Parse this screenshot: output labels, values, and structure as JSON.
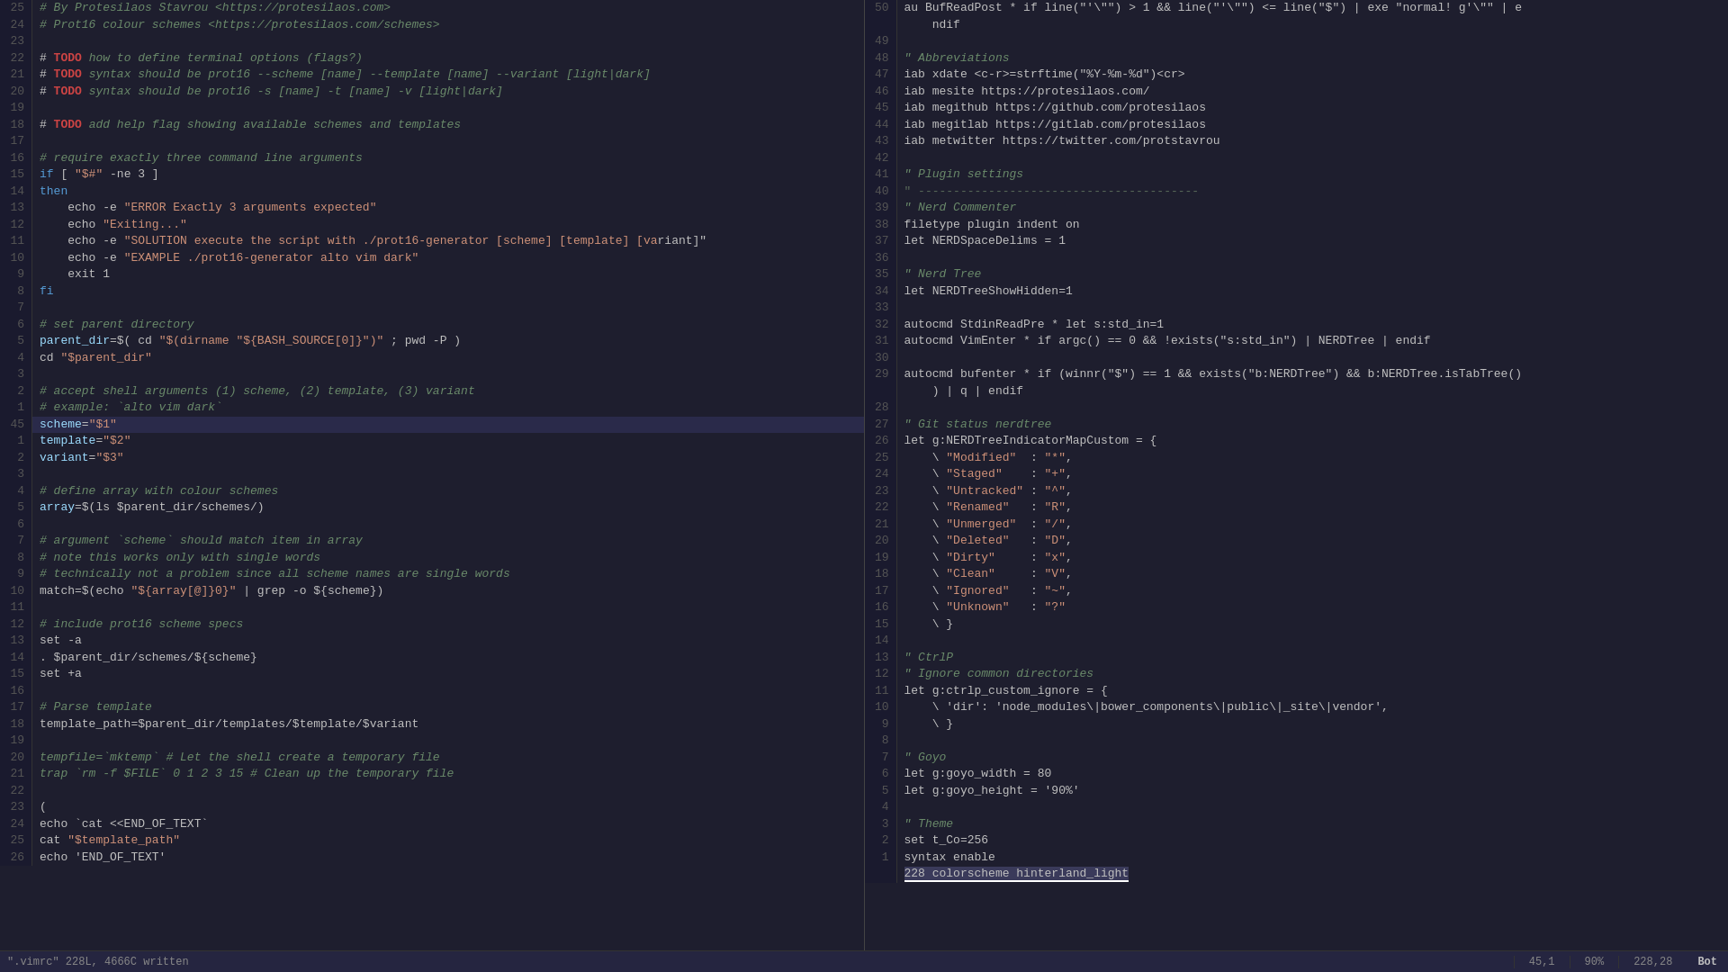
{
  "left_pane": {
    "lines": [
      {
        "num": "25",
        "content": [
          {
            "t": "# By Protesilaos Stavrou <https://protesilaos.com>",
            "c": "c-comment"
          }
        ]
      },
      {
        "num": "24",
        "content": [
          {
            "t": "# Prot16 colour schemes <https://protesilaos.com/schemes>",
            "c": "c-comment"
          }
        ]
      },
      {
        "num": "23",
        "content": []
      },
      {
        "num": "22",
        "content": [
          {
            "t": "# "
          },
          {
            "t": "TODO",
            "c": "c-todo"
          },
          {
            "t": " how to define terminal options (flags?)",
            "c": "c-comment"
          }
        ]
      },
      {
        "num": "21",
        "content": [
          {
            "t": "# "
          },
          {
            "t": "TODO",
            "c": "c-todo"
          },
          {
            "t": " syntax should be prot16 --scheme [name] --template [name] --variant [light|dark]",
            "c": "c-comment"
          }
        ]
      },
      {
        "num": "20",
        "content": [
          {
            "t": "# "
          },
          {
            "t": "TODO",
            "c": "c-todo"
          },
          {
            "t": " syntax should be prot16 -s [name] -t [name] -v [light|dark]",
            "c": "c-comment"
          }
        ]
      },
      {
        "num": "19",
        "content": []
      },
      {
        "num": "18",
        "content": [
          {
            "t": "# "
          },
          {
            "t": "TODO",
            "c": "c-todo"
          },
          {
            "t": " add help flag showing available schemes and templates",
            "c": "c-comment"
          }
        ]
      },
      {
        "num": "17",
        "content": []
      },
      {
        "num": "16",
        "content": [
          {
            "t": "# require exactly three command line arguments",
            "c": "c-comment"
          }
        ]
      },
      {
        "num": "15",
        "content": [
          {
            "t": "if",
            "c": "c-keyword"
          },
          {
            "t": " [ "
          },
          {
            "t": "\"$#\"",
            "c": "c-string"
          },
          {
            "t": " -ne 3 ]"
          }
        ]
      },
      {
        "num": "14",
        "content": [
          {
            "t": "then",
            "c": "c-keyword"
          }
        ]
      },
      {
        "num": "13",
        "content": [
          {
            "t": "    echo -e "
          },
          {
            "t": "\"ERROR Exactly 3 arguments expected\"",
            "c": "c-string"
          }
        ]
      },
      {
        "num": "12",
        "content": [
          {
            "t": "    echo "
          },
          {
            "t": "\"Exiting...\"",
            "c": "c-string"
          }
        ]
      },
      {
        "num": "11",
        "content": [
          {
            "t": "    echo -e "
          },
          {
            "t": "\"SOLUTION execute the script with ./prot16-generator [scheme] [template] [va",
            "c": "c-string"
          },
          {
            "t": "riant]\""
          }
        ]
      },
      {
        "num": "10",
        "content": [
          {
            "t": "    echo -e "
          },
          {
            "t": "\"EXAMPLE ./prot16-generator alto vim dark\"",
            "c": "c-string"
          }
        ]
      },
      {
        "num": " 9",
        "content": [
          {
            "t": "    exit 1"
          }
        ]
      },
      {
        "num": " 8",
        "content": [
          {
            "t": "fi",
            "c": "c-keyword"
          }
        ]
      },
      {
        "num": " 7",
        "content": []
      },
      {
        "num": " 6",
        "content": [
          {
            "t": "# set parent directory",
            "c": "c-comment"
          }
        ]
      },
      {
        "num": " 5",
        "content": [
          {
            "t": "parent_dir",
            "c": "c-var"
          },
          {
            "t": "=$( cd "
          },
          {
            "t": "\"$(dirname \"${BASH_SOURCE[0]}\")\"",
            "c": "c-string"
          },
          {
            "t": " ; pwd -P )"
          }
        ]
      },
      {
        "num": " 4",
        "content": [
          {
            "t": "cd "
          },
          {
            "t": "\"$parent_dir\"",
            "c": "c-string"
          }
        ]
      },
      {
        "num": " 3",
        "content": []
      },
      {
        "num": " 2",
        "content": [
          {
            "t": "# accept shell arguments (1) scheme, (2) template, (3) variant",
            "c": "c-comment"
          }
        ]
      },
      {
        "num": " 1",
        "content": [
          {
            "t": "# example: `alto vim dark`",
            "c": "c-comment"
          }
        ]
      },
      {
        "num": "45",
        "highlighted": true,
        "content": [
          {
            "t": "scheme",
            "c": "c-var"
          },
          {
            "t": "="
          },
          {
            "t": "\"$1\"",
            "c": "c-string"
          }
        ]
      },
      {
        "num": " 1",
        "content": [
          {
            "t": "template",
            "c": "c-var"
          },
          {
            "t": "="
          },
          {
            "t": "\"$2\"",
            "c": "c-string"
          }
        ]
      },
      {
        "num": " 2",
        "content": [
          {
            "t": "variant",
            "c": "c-var"
          },
          {
            "t": "="
          },
          {
            "t": "\"$3\"",
            "c": "c-string"
          }
        ]
      },
      {
        "num": " 3",
        "content": []
      },
      {
        "num": " 4",
        "content": [
          {
            "t": "# define array with colour schemes",
            "c": "c-comment"
          }
        ]
      },
      {
        "num": " 5",
        "content": [
          {
            "t": "array",
            "c": "c-var"
          },
          {
            "t": "=$(ls $parent_dir/schemes/)"
          }
        ]
      },
      {
        "num": " 6",
        "content": []
      },
      {
        "num": " 7",
        "content": [
          {
            "t": "# argument `scheme` should match item in array",
            "c": "c-comment"
          }
        ]
      },
      {
        "num": " 8",
        "content": [
          {
            "t": "# note this works only with single words",
            "c": "c-comment"
          }
        ]
      },
      {
        "num": " 9",
        "content": [
          {
            "t": "# technically not a problem since all scheme names are single words",
            "c": "c-comment"
          }
        ]
      },
      {
        "num": "10",
        "content": [
          {
            "t": "match=$(echo "
          },
          {
            "t": "\"${array[@]}",
            "c": "c-string"
          },
          {
            "t": "0}",
            "c": "c-string"
          },
          {
            "t": "\"",
            "c": "c-string"
          },
          {
            "t": " | grep -o ${scheme})"
          }
        ]
      },
      {
        "num": "11",
        "content": []
      },
      {
        "num": "12",
        "content": [
          {
            "t": "# include prot16 scheme specs",
            "c": "c-comment"
          }
        ]
      },
      {
        "num": "13",
        "content": [
          {
            "t": "set -a"
          }
        ]
      },
      {
        "num": "14",
        "content": [
          {
            "t": ". $parent_dir/schemes/${scheme}"
          }
        ]
      },
      {
        "num": "15",
        "content": [
          {
            "t": "set +a"
          }
        ]
      },
      {
        "num": "16",
        "content": []
      },
      {
        "num": "17",
        "content": [
          {
            "t": "# Parse template",
            "c": "c-comment"
          }
        ]
      },
      {
        "num": "18",
        "content": [
          {
            "t": "template_path=$parent_dir/templates/$template/$variant"
          }
        ]
      },
      {
        "num": "19",
        "content": []
      },
      {
        "num": "20",
        "content": [
          {
            "t": "tempfile=`mktemp` # Let the shell create a temporary file",
            "c": "c-comment"
          }
        ]
      },
      {
        "num": "21",
        "content": [
          {
            "t": "trap `rm -f $FILE` 0 1 2 3 15 # Clean up the temporary file",
            "c": "c-comment"
          }
        ]
      },
      {
        "num": "22",
        "content": []
      },
      {
        "num": "23",
        "content": [
          {
            "t": "("
          }
        ]
      },
      {
        "num": "24",
        "content": [
          {
            "t": "echo `cat <<END_OF_TEXT`"
          }
        ]
      },
      {
        "num": "25",
        "content": [
          {
            "t": "cat "
          },
          {
            "t": "\"$template_path\"",
            "c": "c-string"
          }
        ]
      },
      {
        "num": "26",
        "content": [
          {
            "t": "echo 'END_OF_TEXT'"
          }
        ]
      }
    ]
  },
  "right_pane": {
    "lines": [
      {
        "num": "50",
        "content": [
          {
            "t": "au BufReadPost * if line(\"'\\\"\") > 1 && line(\"'\\\"\") <= line(\"$\") | exe \"normal! g'\\\"\" | e"
          }
        ]
      },
      {
        "num": "",
        "content": [
          {
            "t": "    ndif"
          }
        ]
      },
      {
        "num": "49",
        "content": []
      },
      {
        "num": "48",
        "content": [
          {
            "t": "\" Abbreviations",
            "c": "c-comment"
          }
        ]
      },
      {
        "num": "47",
        "content": [
          {
            "t": "iab xdate <c-r>=strftime(\"%Y-%m-%d\")<cr>"
          }
        ]
      },
      {
        "num": "46",
        "content": [
          {
            "t": "iab mesite https://protesilaos.com/"
          }
        ]
      },
      {
        "num": "45",
        "content": [
          {
            "t": "iab megithub https://github.com/protesilaos"
          }
        ]
      },
      {
        "num": "44",
        "content": [
          {
            "t": "iab megitlab https://gitlab.com/protesilaos"
          }
        ]
      },
      {
        "num": "43",
        "content": [
          {
            "t": "iab metwitter https://twitter.com/protstavrou"
          }
        ]
      },
      {
        "num": "42",
        "content": []
      },
      {
        "num": "41",
        "content": [
          {
            "t": "\" Plugin settings",
            "c": "c-comment"
          }
        ]
      },
      {
        "num": "40",
        "content": [
          {
            "t": "\" ----------------------------------------",
            "c": "c-dimmed"
          }
        ]
      },
      {
        "num": "39",
        "content": [
          {
            "t": "\" Nerd Commenter",
            "c": "c-comment"
          }
        ]
      },
      {
        "num": "38",
        "content": [
          {
            "t": "filetype plugin indent on"
          }
        ]
      },
      {
        "num": "37",
        "content": [
          {
            "t": "let NERDSpaceDelims = 1"
          }
        ]
      },
      {
        "num": "36",
        "content": []
      },
      {
        "num": "35",
        "content": [
          {
            "t": "\" Nerd Tree",
            "c": "c-comment"
          }
        ]
      },
      {
        "num": "34",
        "content": [
          {
            "t": "let NERDTreeShowHidden=1"
          }
        ]
      },
      {
        "num": "33",
        "content": []
      },
      {
        "num": "32",
        "content": [
          {
            "t": "autocmd StdinReadPre * let s:std_in=1"
          }
        ]
      },
      {
        "num": "31",
        "content": [
          {
            "t": "autocmd VimEnter * if argc() == 0 && !exists(\"s:std_in\") | NERDTree | endif"
          }
        ]
      },
      {
        "num": "30",
        "content": []
      },
      {
        "num": "29",
        "content": [
          {
            "t": "autocmd bufenter * if (winnr(\"$\") == 1 && exists(\"b:NERDTree\") && b:NERDTree.isTabTree()"
          }
        ]
      },
      {
        "num": "",
        "content": [
          {
            "t": "    ) | q | endif"
          }
        ]
      },
      {
        "num": "28",
        "content": []
      },
      {
        "num": "27",
        "content": [
          {
            "t": "\" Git status nerdtree",
            "c": "c-comment"
          }
        ]
      },
      {
        "num": "26",
        "content": [
          {
            "t": "let g:NERDTreeIndicatorMapCustom = {"
          }
        ]
      },
      {
        "num": "25",
        "content": [
          {
            "t": "    \\ "
          },
          {
            "t": "\"Modified\"",
            "c": "c-string"
          },
          {
            "t": "  : "
          },
          {
            "t": "\"*\"",
            "c": "c-string"
          },
          {
            "t": ","
          }
        ]
      },
      {
        "num": "24",
        "content": [
          {
            "t": "    \\ "
          },
          {
            "t": "\"Staged\"",
            "c": "c-string"
          },
          {
            "t": "    : "
          },
          {
            "t": "\"+\"",
            "c": "c-string"
          },
          {
            "t": ","
          }
        ]
      },
      {
        "num": "23",
        "content": [
          {
            "t": "    \\ "
          },
          {
            "t": "\"Untracked\"",
            "c": "c-string"
          },
          {
            "t": " : "
          },
          {
            "t": "\"^\"",
            "c": "c-string"
          },
          {
            "t": ","
          }
        ]
      },
      {
        "num": "22",
        "content": [
          {
            "t": "    \\ "
          },
          {
            "t": "\"Renamed\"",
            "c": "c-string"
          },
          {
            "t": "   : "
          },
          {
            "t": "\"R\"",
            "c": "c-string"
          },
          {
            "t": ","
          }
        ]
      },
      {
        "num": "21",
        "content": [
          {
            "t": "    \\ "
          },
          {
            "t": "\"Unmerged\"",
            "c": "c-string"
          },
          {
            "t": "  : "
          },
          {
            "t": "\"/\"",
            "c": "c-string"
          },
          {
            "t": ","
          }
        ]
      },
      {
        "num": "20",
        "content": [
          {
            "t": "    \\ "
          },
          {
            "t": "\"Deleted\"",
            "c": "c-string"
          },
          {
            "t": "   : "
          },
          {
            "t": "\"D\"",
            "c": "c-string"
          },
          {
            "t": ","
          }
        ]
      },
      {
        "num": "19",
        "content": [
          {
            "t": "    \\ "
          },
          {
            "t": "\"Dirty\"",
            "c": "c-string"
          },
          {
            "t": "     : "
          },
          {
            "t": "\"x\"",
            "c": "c-string"
          },
          {
            "t": ","
          }
        ]
      },
      {
        "num": "18",
        "content": [
          {
            "t": "    \\ "
          },
          {
            "t": "\"Clean\"",
            "c": "c-string"
          },
          {
            "t": "     : "
          },
          {
            "t": "\"V\"",
            "c": "c-string"
          },
          {
            "t": ","
          }
        ]
      },
      {
        "num": "17",
        "content": [
          {
            "t": "    \\ "
          },
          {
            "t": "\"Ignored\"",
            "c": "c-string"
          },
          {
            "t": "   : "
          },
          {
            "t": "\"~\"",
            "c": "c-string"
          },
          {
            "t": ","
          }
        ]
      },
      {
        "num": "16",
        "content": [
          {
            "t": "    \\ "
          },
          {
            "t": "\"Unknown\"",
            "c": "c-string"
          },
          {
            "t": "   : "
          },
          {
            "t": "\"?\"",
            "c": "c-string"
          }
        ]
      },
      {
        "num": "15",
        "content": [
          {
            "t": "    \\ }"
          }
        ]
      },
      {
        "num": "14",
        "content": []
      },
      {
        "num": "13",
        "content": [
          {
            "t": "\" CtrlP",
            "c": "c-comment"
          }
        ]
      },
      {
        "num": "12",
        "content": [
          {
            "t": "\" Ignore common directories",
            "c": "c-comment"
          }
        ]
      },
      {
        "num": "11",
        "content": [
          {
            "t": "let g:ctrlp_custom_ignore = {"
          }
        ]
      },
      {
        "num": "10",
        "content": [
          {
            "t": "    \\ 'dir': 'node_modules\\|bower_components\\|public\\|_site\\|vendor',"
          }
        ]
      },
      {
        "num": " 9",
        "content": [
          {
            "t": "    \\ }"
          }
        ]
      },
      {
        "num": " 8",
        "content": []
      },
      {
        "num": " 7",
        "content": [
          {
            "t": "\" Goyo",
            "c": "c-comment"
          }
        ]
      },
      {
        "num": " 6",
        "content": [
          {
            "t": "let g:goyo_width = 80"
          }
        ]
      },
      {
        "num": " 5",
        "content": [
          {
            "t": "let g:goyo_height = '90%'"
          }
        ]
      },
      {
        "num": " 4",
        "content": []
      },
      {
        "num": " 3",
        "content": [
          {
            "t": "\" Theme",
            "c": "c-comment"
          }
        ]
      },
      {
        "num": " 2",
        "content": [
          {
            "t": "set t_Co=256"
          }
        ]
      },
      {
        "num": " 1",
        "content": [
          {
            "t": "syntax enable"
          }
        ]
      },
      {
        "num": "",
        "content": [
          {
            "t": "228 colorscheme hinterland_light",
            "cursor": true
          }
        ]
      }
    ]
  },
  "status_bar": {
    "left": "\".vimrc\" 228L, 4666C written",
    "left_pos": "45,1",
    "left_pct": "90%",
    "right_pos": "228,28",
    "bot": "Bot"
  }
}
